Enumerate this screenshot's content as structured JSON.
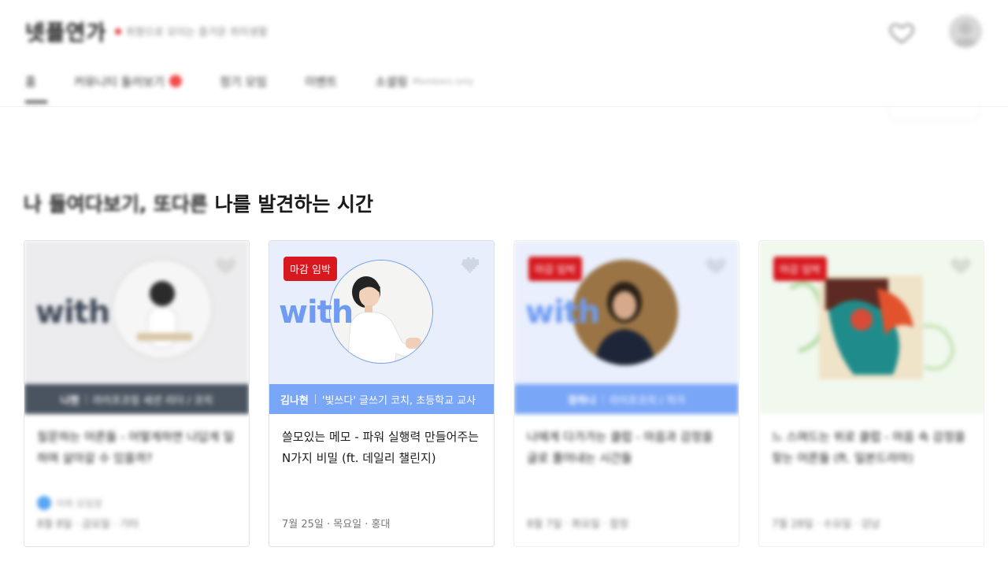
{
  "header": {
    "logo": "넷플연가",
    "tagline": "취향으로 모이는 즐거운 취미생활",
    "tabs": [
      {
        "label": "홈"
      },
      {
        "label": "커뮤니티 둘러보기"
      },
      {
        "label": "정기 모임"
      },
      {
        "label": "이벤트"
      },
      {
        "label": "소셜링",
        "sub": "Members only"
      }
    ]
  },
  "section": {
    "title_prefix": "나 들여다보기, 또다른",
    "title_suffix": "나를 발견하는 시간"
  },
  "cards": [
    {
      "with_word": "with",
      "strip_name": "나현",
      "strip_desc": "라이프코칭 세션 리더 / 코치",
      "title": "질문하는 어른들 - 어떻게하면 나답게 일하며 살아갈 수 있을까?",
      "host": "이하 모임장",
      "meta": "8월 8일 · 금요일 · 기타"
    },
    {
      "deadline": "마감 임박",
      "with_word": "with",
      "strip_name": "김나현",
      "strip_desc": "'빛쓰다' 글쓰기 코치, 초등학교 교사",
      "title": "쓸모있는 메모 - 파워 실행력 만들어주는 N가지 비밀 (ft. 데일리 챌린지)",
      "meta": "7월 25일 · 목요일 · 홍대"
    },
    {
      "deadline": "마감 임박",
      "with_word": "with",
      "strip_name": "정하나",
      "strip_desc": "라이프코치 / 작가",
      "title": "나에게 다가가는 클럽 - 마음과 감정을 글로 풀어내는 시간들",
      "meta": "8월 7일 · 화요일 · 합정"
    },
    {
      "deadline": "마감 임박",
      "title": "느 스며드는 위로 클럽 - 마음 속 감정을 찾는 어른들 (ft. 일본드라마)",
      "meta": "7월 28일 · 수요일 · 강남"
    }
  ],
  "colors": {
    "deadline_badge": "#d7191f",
    "strip_blue": "#7aa6f7",
    "strip_dark": "#4a5460",
    "with_blue": "#6f9cf2"
  }
}
